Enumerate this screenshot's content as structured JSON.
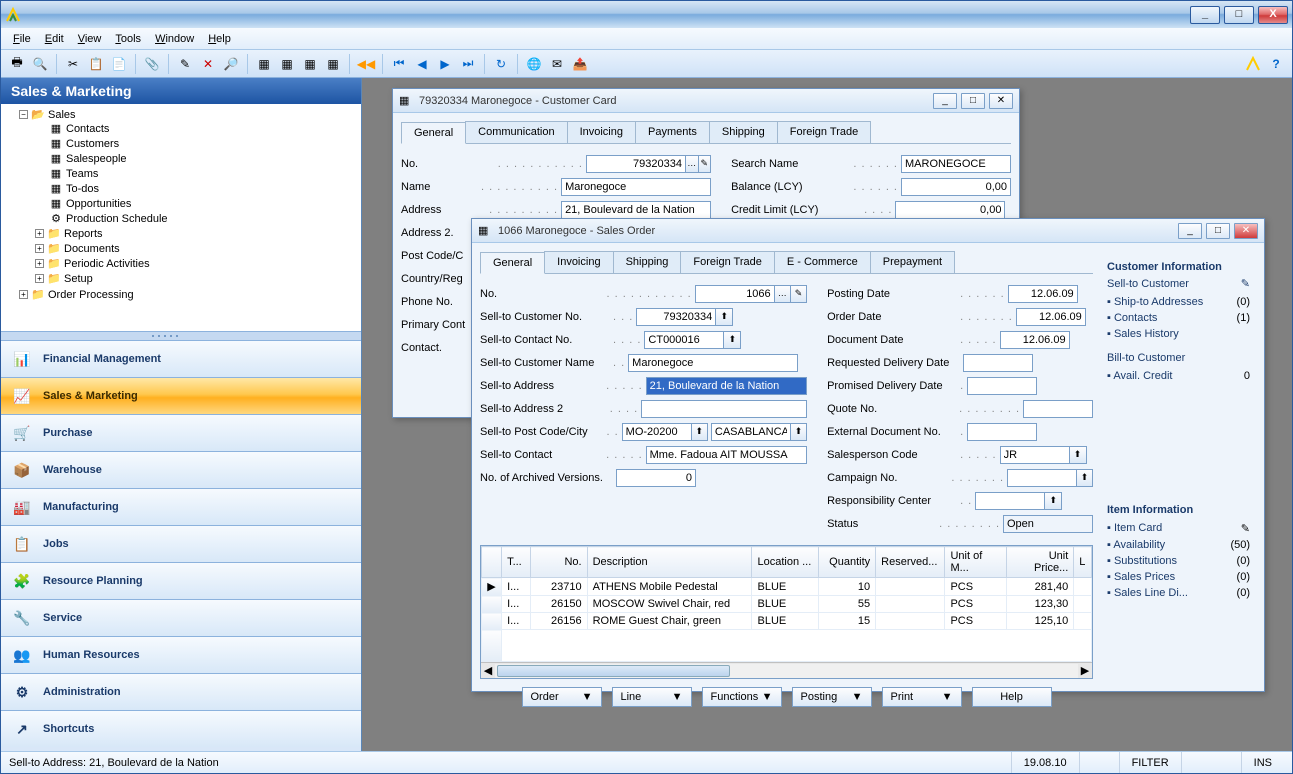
{
  "titlebar": {
    "text": ""
  },
  "menus": [
    "File",
    "Edit",
    "View",
    "Tools",
    "Window",
    "Help"
  ],
  "nav": {
    "header": "Sales & Marketing",
    "tree": {
      "root": "Sales",
      "items": [
        "Contacts",
        "Customers",
        "Salespeople",
        "Teams",
        "To-dos",
        "Opportunities",
        "Production Schedule",
        "Reports",
        "Documents",
        "Periodic Activities",
        "Setup"
      ],
      "root2": "Order Processing"
    },
    "modules": [
      "Financial Management",
      "Sales & Marketing",
      "Purchase",
      "Warehouse",
      "Manufacturing",
      "Jobs",
      "Resource Planning",
      "Service",
      "Human Resources",
      "Administration",
      "Shortcuts"
    ]
  },
  "customer_card": {
    "title": "79320334 Maronegoce - Customer Card",
    "tabs": [
      "General",
      "Communication",
      "Invoicing",
      "Payments",
      "Shipping",
      "Foreign Trade"
    ],
    "no_label": "No.",
    "no": "79320334",
    "name_label": "Name",
    "name": "Maronegoce",
    "address_label": "Address",
    "address": "21, Boulevard de la Nation",
    "address2_label": "Address 2.",
    "postcode_label": "Post Code/C",
    "country_label": "Country/Reg",
    "phone_label": "Phone No.",
    "primary_label": "Primary Cont",
    "contact_label": "Contact.",
    "search_label": "Search Name",
    "search": "MARONEGOCE",
    "balance_label": "Balance (LCY)",
    "balance": "0,00",
    "credit_label": "Credit Limit (LCY)",
    "credit": "0,00"
  },
  "sales_order": {
    "title": "1066 Maronegoce - Sales Order",
    "tabs": [
      "General",
      "Invoicing",
      "Shipping",
      "Foreign Trade",
      "E - Commerce",
      "Prepayment"
    ],
    "fields": {
      "no_label": "No.",
      "no": "1066",
      "sellto_custno_label": "Sell-to Customer No.",
      "sellto_custno": "79320334",
      "sellto_contno_label": "Sell-to Contact No.",
      "sellto_contno": "CT000016",
      "sellto_name_label": "Sell-to Customer Name",
      "sellto_name": "Maronegoce",
      "sellto_addr_label": "Sell-to Address",
      "sellto_addr": "21, Boulevard de la Nation",
      "sellto_addr2_label": "Sell-to Address 2",
      "sellto_pc_label": "Sell-to Post Code/City",
      "sellto_pc": "MO-20200",
      "sellto_city": "CASABLANCA",
      "sellto_contact_label": "Sell-to Contact",
      "sellto_contact": "Mme. Fadoua AIT MOUSSA",
      "archived_label": "No. of Archived Versions.",
      "archived": "0",
      "posting_date_label": "Posting Date",
      "posting_date": "12.06.09",
      "order_date_label": "Order Date",
      "order_date": "12.06.09",
      "doc_date_label": "Document Date",
      "doc_date": "12.06.09",
      "req_date_label": "Requested Delivery Date",
      "prom_date_label": "Promised Delivery Date",
      "quote_label": "Quote No.",
      "extdoc_label": "External Document No.",
      "salesperson_label": "Salesperson Code",
      "salesperson": "JR",
      "campaign_label": "Campaign No.",
      "resp_label": "Responsibility Center",
      "status_label": "Status",
      "status": "Open"
    },
    "grid": {
      "cols": [
        "T...",
        "No.",
        "Description",
        "Location ...",
        "Quantity",
        "Reserved...",
        "Unit of M...",
        "Unit Price...",
        "L"
      ],
      "rows": [
        {
          "t": "I...",
          "no": "23710",
          "desc": "ATHENS Mobile Pedestal",
          "loc": "BLUE",
          "qty": "10",
          "res": "",
          "uom": "PCS",
          "price": "281,40"
        },
        {
          "t": "I...",
          "no": "26150",
          "desc": "MOSCOW Swivel Chair, red",
          "loc": "BLUE",
          "qty": "55",
          "res": "",
          "uom": "PCS",
          "price": "123,30"
        },
        {
          "t": "I...",
          "no": "26156",
          "desc": "ROME Guest Chair, green",
          "loc": "BLUE",
          "qty": "15",
          "res": "",
          "uom": "PCS",
          "price": "125,10"
        }
      ]
    },
    "buttons": [
      "Order",
      "Line",
      "Functions",
      "Posting",
      "Print",
      "Help"
    ],
    "side": {
      "h1": "Customer Information",
      "h2": "Sell-to Customer",
      "links1": [
        {
          "lbl": "Ship-to Addresses",
          "val": "(0)"
        },
        {
          "lbl": "Contacts",
          "val": "(1)"
        },
        {
          "lbl": "Sales History",
          "val": ""
        }
      ],
      "h3": "Bill-to Customer",
      "links2": [
        {
          "lbl": "Avail. Credit",
          "val": "0"
        }
      ],
      "h4": "Item Information",
      "links3": [
        {
          "lbl": "Item Card",
          "val": ""
        },
        {
          "lbl": "Availability",
          "val": "(50)"
        },
        {
          "lbl": "Substitutions",
          "val": "(0)"
        },
        {
          "lbl": "Sales Prices",
          "val": "(0)"
        },
        {
          "lbl": "Sales Line Di...",
          "val": "(0)"
        }
      ]
    }
  },
  "status": {
    "left": "Sell-to Address: 21, Boulevard de la Nation",
    "date": "19.08.10",
    "filter": "FILTER",
    "ins": "INS"
  }
}
